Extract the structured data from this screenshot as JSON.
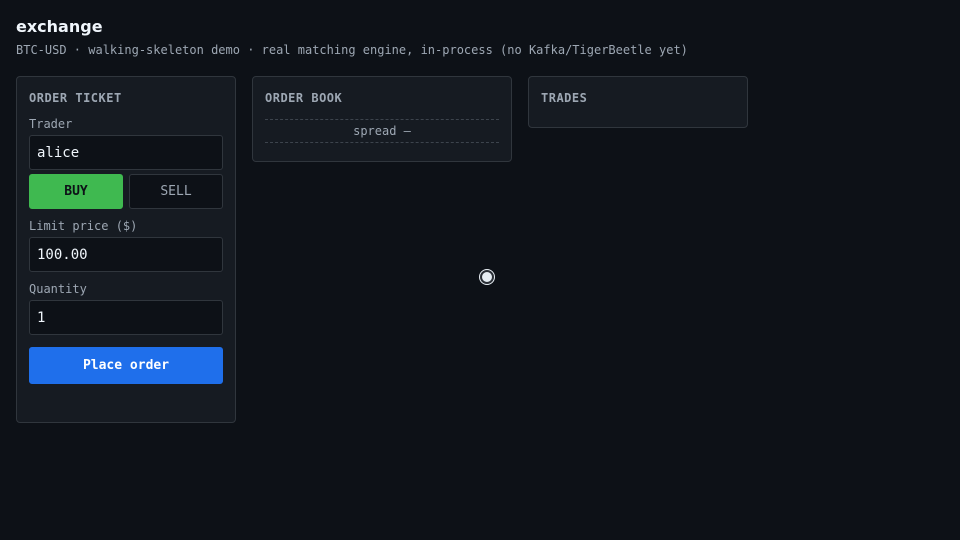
{
  "header": {
    "title": "exchange",
    "subtitle": "BTC-USD · walking-skeleton demo · real matching engine, in-process (no Kafka/TigerBeetle yet)"
  },
  "order_ticket": {
    "title": "ORDER TICKET",
    "trader_label": "Trader",
    "trader_value": "alice",
    "buy_label": "BUY",
    "sell_label": "SELL",
    "selected_side": "BUY",
    "price_label": "Limit price ($)",
    "price_value": "100.00",
    "quantity_label": "Quantity",
    "quantity_value": "1",
    "submit_label": "Place order"
  },
  "order_book": {
    "title": "ORDER BOOK",
    "spread_text": "spread —"
  },
  "trades": {
    "title": "TRADES"
  },
  "colors": {
    "background": "#0d1117",
    "panel": "#161b22",
    "buy": "#3fb950",
    "primary": "#1f6feb"
  }
}
